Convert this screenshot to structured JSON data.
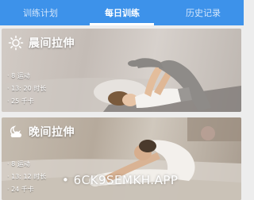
{
  "tabs": [
    {
      "label": "训练计划",
      "active": false
    },
    {
      "label": "每日训练",
      "active": true
    },
    {
      "label": "历史记录",
      "active": false
    }
  ],
  "cards": [
    {
      "title": "晨间拉伸",
      "icon": "sun-icon",
      "stats": [
        "· 8 运动",
        "· 13: 20 时长",
        "· 25 千卡"
      ]
    },
    {
      "title": "晚间拉伸",
      "icon": "moon-cloud-icon",
      "stats": [
        "· 8 运动",
        "· 13: 12 时长",
        "· 24 千卡"
      ]
    }
  ],
  "watermark": "• 6CK9SEMKH.APP",
  "colors": {
    "tabbar": "#3d92ea",
    "tab_active_text": "#ffffff",
    "tab_inactive_text": "#d4e6fb",
    "background": "#ededed"
  }
}
